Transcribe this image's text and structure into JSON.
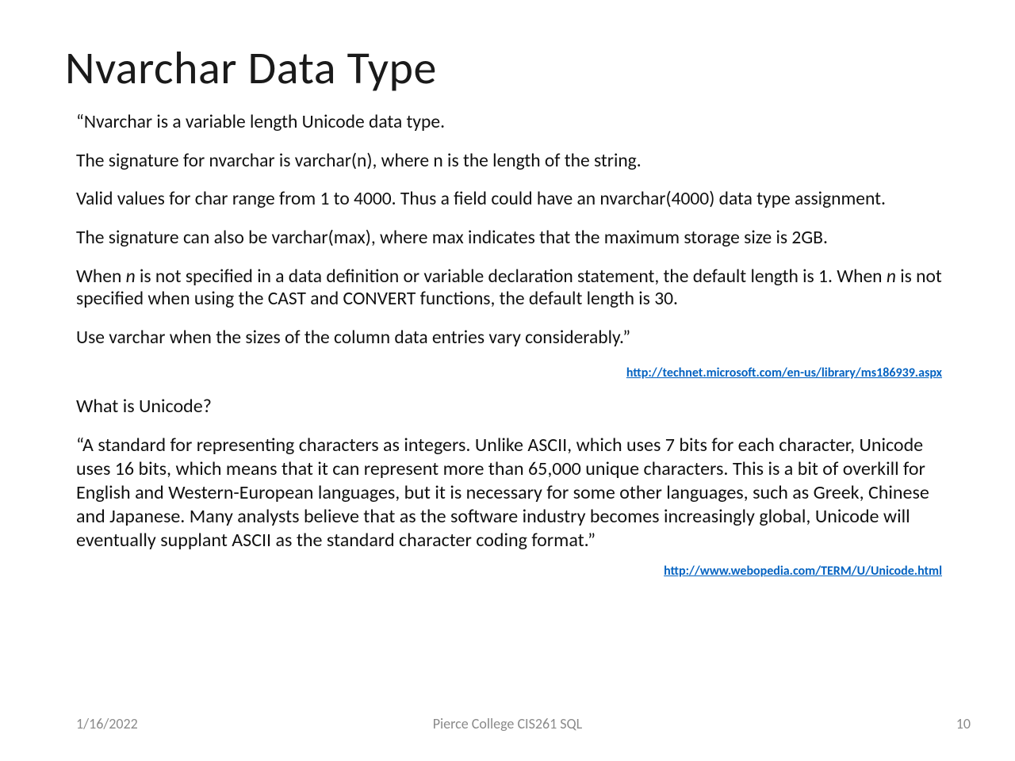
{
  "title": "Nvarchar Data Type",
  "paragraphs": {
    "p1": "“Nvarchar is a variable length Unicode data type.",
    "p2": "The signature for nvarchar is varchar(n), where n is the length of the string.",
    "p3": "Valid values for char range from 1 to 4000. Thus a field could have an nvarchar(4000) data type assignment.",
    "p4": "The signature can also be varchar(max), where max indicates that the maximum storage size is 2GB.",
    "p5_a": "When ",
    "p5_n1": "n",
    "p5_b": " is not specified in a data definition or variable declaration statement, the default length is 1. When ",
    "p5_n2": "n",
    "p5_c": " is not specified when using the CAST and CONVERT functions, the default length is 30.",
    "p6": "Use varchar when the sizes of the column data entries vary considerably.”",
    "link1": "http://technet.microsoft.com/en-us/library/ms186939.aspx",
    "q": "What is Unicode?",
    "quote2": "“A standard for representing characters as integers. Unlike ASCII, which uses 7 bits for each character, Unicode uses 16 bits, which means that it can represent more than 65,000 unique characters. This is a bit of overkill for English and Western-European languages, but it is necessary for some other languages, such as Greek, Chinese and Japanese. Many analysts believe that as the software industry becomes increasingly global, Unicode will eventually supplant ASCII as the standard character coding format.”",
    "link2": "http://www.webopedia.com/TERM/U/Unicode.html"
  },
  "footer": {
    "date": "1/16/2022",
    "center": "Pierce College CIS261 SQL",
    "page": "10"
  }
}
